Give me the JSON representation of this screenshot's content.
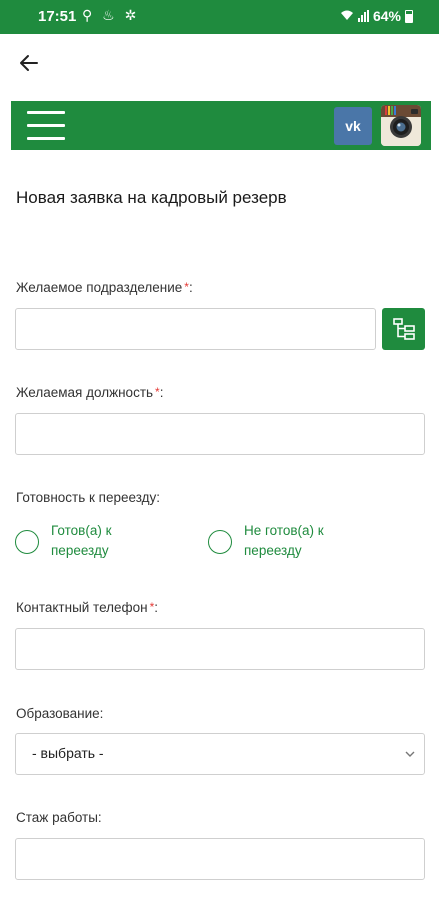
{
  "status_bar": {
    "time": "17:51",
    "left_icons": "⚲ ♨ ✲",
    "battery": "64%"
  },
  "header": {
    "vk_label": "vk",
    "icons": [
      "arrow-left-icon",
      "menu-icon",
      "vk-icon",
      "instagram-icon"
    ]
  },
  "form": {
    "title": "Новая заявка на кадровый резерв",
    "required_mark": "*",
    "division": {
      "label": "Желаемое подразделение",
      "suffix": ":",
      "value": ""
    },
    "position": {
      "label": "Желаемая должность",
      "suffix": ":",
      "value": ""
    },
    "relocation": {
      "label": "Готовность к переезду:",
      "options": [
        {
          "line1": "Готов(а) к",
          "line2": "переезду",
          "selected": false
        },
        {
          "line1": "Не готов(а) к",
          "line2": "переезду",
          "selected": false
        }
      ]
    },
    "phone": {
      "label": "Контактный телефон",
      "suffix": ":",
      "value": ""
    },
    "education": {
      "label": "Образование:",
      "selected": "- выбрать -"
    },
    "experience": {
      "label": "Стаж работы:",
      "value": ""
    }
  },
  "colors": {
    "brand_green": "#1f8b3e",
    "required_red": "#e53935",
    "vk_blue": "#4a76a8"
  }
}
